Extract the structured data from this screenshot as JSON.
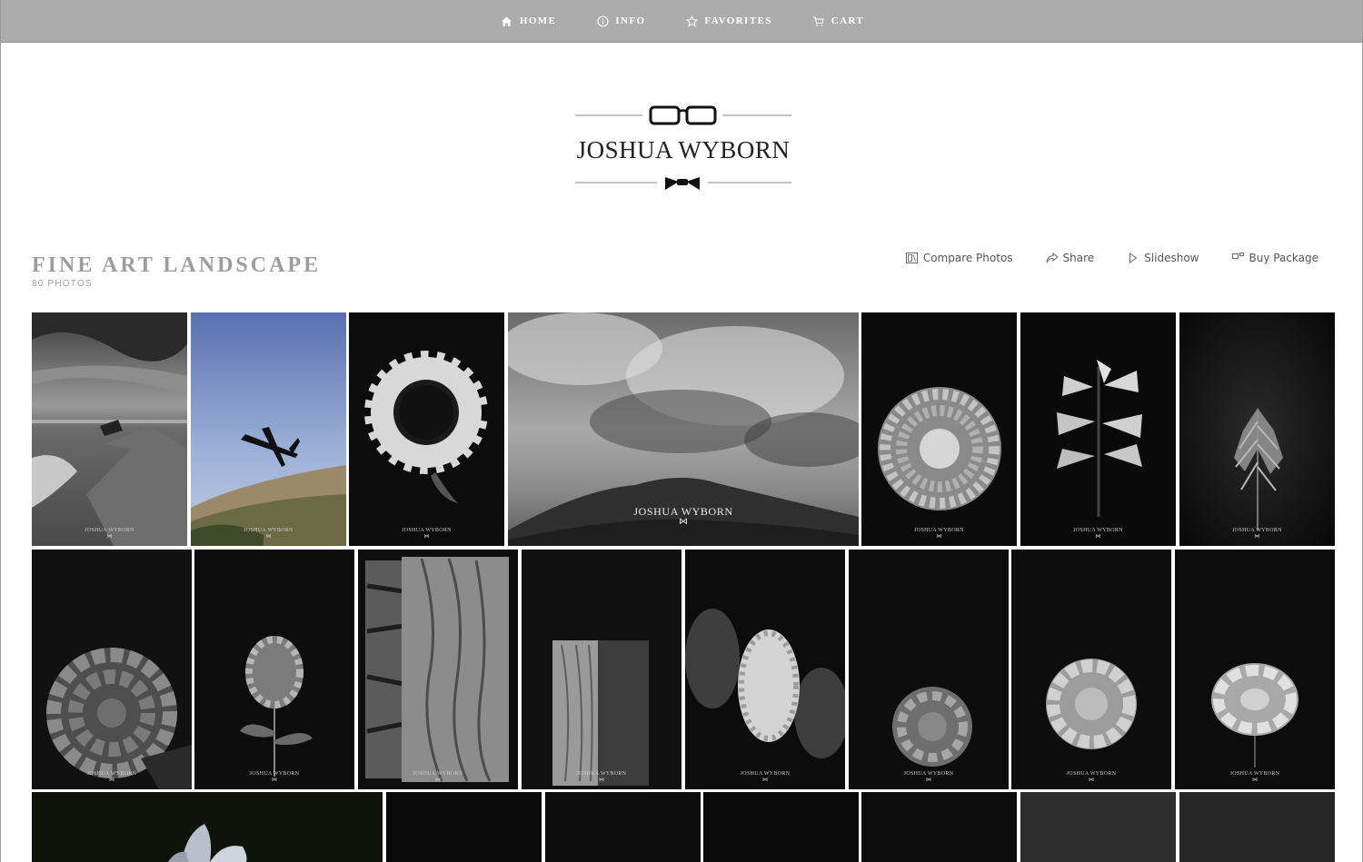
{
  "nav": {
    "items": [
      {
        "label": "HOME",
        "icon": "home-icon"
      },
      {
        "label": "INFO",
        "icon": "info-icon"
      },
      {
        "label": "FAVORITES",
        "icon": "star-icon"
      },
      {
        "label": "CART",
        "icon": "cart-icon"
      }
    ]
  },
  "brand": {
    "name": "JOSHUA WYBORN"
  },
  "gallery": {
    "title": "FINE ART LANDSCAPE",
    "count": "80 PHOTOS",
    "actions": [
      {
        "label": "Compare Photos",
        "icon": "compare-icon"
      },
      {
        "label": "Share",
        "icon": "share-icon"
      },
      {
        "label": "Slideshow",
        "icon": "play-icon"
      },
      {
        "label": "Buy Package",
        "icon": "package-icon"
      }
    ],
    "watermark": "JOSHUA WYBORN",
    "photos": [
      {
        "subject": "pier-waves"
      },
      {
        "subject": "airplane-sky"
      },
      {
        "subject": "sunflower"
      },
      {
        "subject": "cloudy-mountain"
      },
      {
        "subject": "dahlia"
      },
      {
        "subject": "lilies"
      },
      {
        "subject": "grass-plume"
      },
      {
        "subject": "hydrangea"
      },
      {
        "subject": "hydrangea-stem"
      },
      {
        "subject": "tree-bark"
      },
      {
        "subject": "log"
      },
      {
        "subject": "lilac"
      },
      {
        "subject": "rose"
      },
      {
        "subject": "hydrangea-bloom"
      },
      {
        "subject": "peony"
      },
      {
        "subject": "flower-partial"
      },
      {
        "subject": "dark-1"
      },
      {
        "subject": "dark-2"
      },
      {
        "subject": "dark-3"
      },
      {
        "subject": "dark-4"
      },
      {
        "subject": "dark-5"
      },
      {
        "subject": "dark-6"
      }
    ]
  }
}
